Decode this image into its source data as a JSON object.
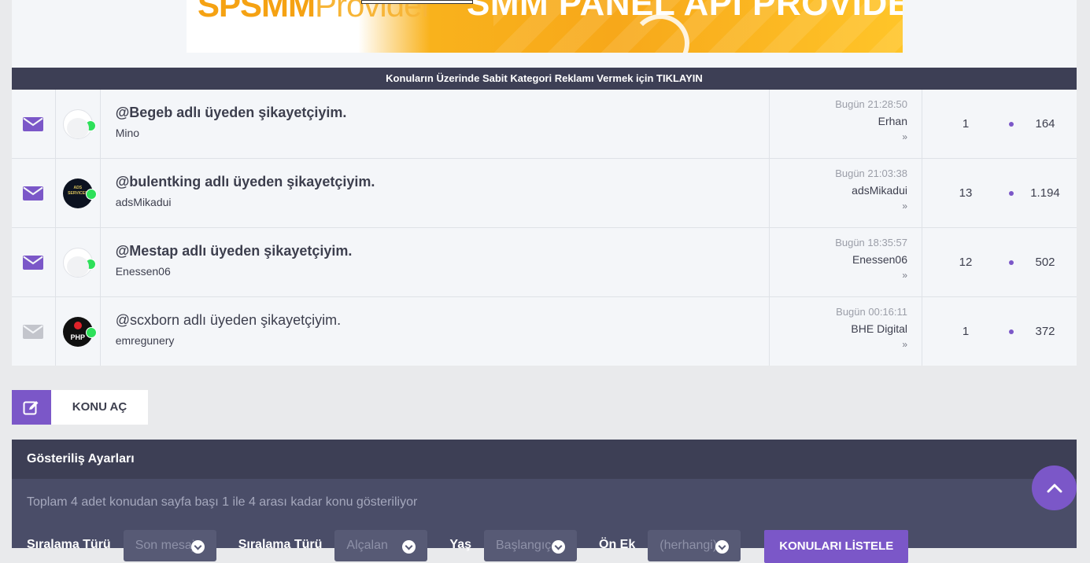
{
  "banner": {
    "brand": "SPSMMProvider",
    "brand_main": "SPSMM",
    "brand_sub": "Provider",
    "headline": "SMM PANEL API PROVIDER"
  },
  "ad_bar": {
    "text": "Konuların Üzerinde Sabit Kategori Reklamı Vermek için TIKLAYIN"
  },
  "topics": [
    {
      "title": "@Begeb adlı üyeden şikayetçiyim.",
      "author": "Mino",
      "unread": true,
      "avatar": "blank",
      "last_time": "Bugün 21:28:50",
      "last_user": "Erhan",
      "replies": "1",
      "views": "164"
    },
    {
      "title": "@bulentking adlı üyeden şikayetçiyim.",
      "author": "adsMikadui",
      "unread": true,
      "avatar": "ads",
      "last_time": "Bugün 21:03:38",
      "last_user": "adsMikadui",
      "replies": "13",
      "views": "1.194"
    },
    {
      "title": "@Mestap adlı üyeden şikayetçiyim.",
      "author": "Enessen06",
      "unread": true,
      "avatar": "blank",
      "last_time": "Bugün 18:35:57",
      "last_user": "Enessen06",
      "replies": "12",
      "views": "502"
    },
    {
      "title": "@scxborn adlı üyeden şikayetçiyim.",
      "author": "emregunery",
      "unread": false,
      "avatar": "php",
      "avatar_text": "PHP",
      "last_time": "Bugün 00:16:11",
      "last_user": "BHE Digital",
      "replies": "1",
      "views": "372"
    }
  ],
  "new_topic": {
    "label": "KONU AÇ"
  },
  "settings": {
    "title": "Gösteriliş Ayarları",
    "info": "Toplam 4 adet konudan sayfa başı 1 ile 4 arası kadar konu gösteriliyor",
    "controls": [
      {
        "label": "Sıralama Türü",
        "value": "Son mesaj"
      },
      {
        "label": "Sıralama Türü",
        "value": "Alçalan"
      },
      {
        "label": "Yaş",
        "value": "Başlangıç"
      },
      {
        "label": "Ön Ek",
        "value": "(herhangi)"
      }
    ],
    "submit": "KONULARI LİSTELE"
  },
  "colors": {
    "accent": "#7b57c8",
    "dark": "#3d3f55",
    "online": "#2ee05a"
  }
}
